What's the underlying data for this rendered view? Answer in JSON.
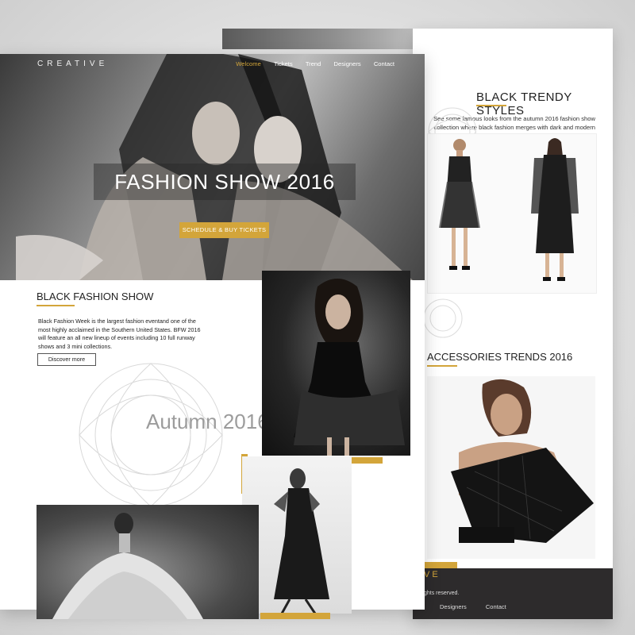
{
  "hero": {
    "logo": "CREATIVE",
    "nav": [
      "Welcome",
      "Tickets",
      "Trend",
      "Designers",
      "Contact"
    ],
    "title": "FASHION SHOW 2016",
    "cta": "SCHEDULE & BUY TICKETS"
  },
  "black_fashion_show": {
    "title": "BLACK FASHION SHOW",
    "description": "Black Fashion Week is the largest fashion eventand one of the most highly acclaimed in the Southern United States. BFW 2016 will feature an all new lineup of events including 10 full runway shows and 3 mini collections.",
    "button": "Discover more",
    "overlay_text": "Autumn 2016"
  },
  "black_trendy_styles": {
    "title": "BLACK TRENDY STYLES",
    "description": "See some famous looks from the autumn 2016 fashion show collection where black fashion merges with dark and modern fashion."
  },
  "accessories": {
    "title": "ACCESSORIES TRENDS 2016"
  },
  "footer": {
    "brand_fragment": "VE",
    "rights": "ghts reserved.",
    "nav": [
      "Designers",
      "Contact"
    ]
  },
  "colors": {
    "accent": "#d3a53a",
    "dark": "#2d2b2c",
    "text": "#222222"
  },
  "icons": [
    "lace-ornament-icon"
  ]
}
